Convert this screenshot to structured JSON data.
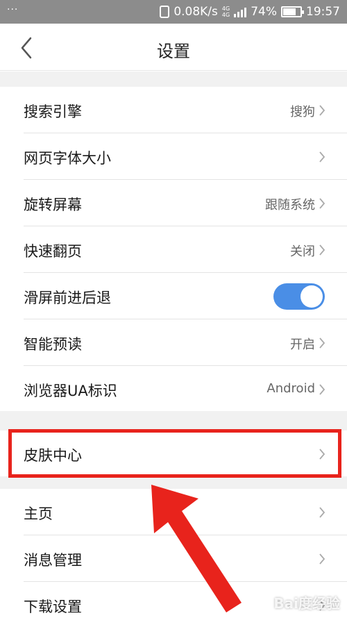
{
  "status_bar": {
    "left": "···",
    "speed": "0.08K/s",
    "network": [
      "4G",
      "4G"
    ],
    "battery_percent": 74,
    "battery_text": "74%",
    "time": "19:57"
  },
  "header": {
    "title": "设置",
    "back_icon": "chevron-left-icon"
  },
  "sections": [
    {
      "items": [
        {
          "label": "搜索引擎",
          "value": "搜狗",
          "chevron": true
        },
        {
          "label": "网页字体大小",
          "value": "",
          "chevron": true
        },
        {
          "label": "旋转屏幕",
          "value": "跟随系统",
          "chevron": true
        },
        {
          "label": "快速翻页",
          "value": "关闭",
          "chevron": true
        },
        {
          "label": "滑屏前进后退",
          "toggle": true,
          "toggle_on": true
        },
        {
          "label": "智能预读",
          "value": "开启",
          "chevron": true
        },
        {
          "label": "浏览器UA标识",
          "value": "Android",
          "chevron": true
        }
      ]
    },
    {
      "items": [
        {
          "label": "皮肤中心",
          "value": "",
          "chevron": true
        }
      ]
    },
    {
      "items": [
        {
          "label": "主页",
          "value": "",
          "chevron": true
        },
        {
          "label": "消息管理",
          "value": "",
          "chevron": true
        },
        {
          "label": "下载设置",
          "value": "",
          "chevron": true
        }
      ]
    }
  ],
  "annotation": {
    "highlight_color": "#e8231c",
    "toggle_color": "#4a8ee6"
  },
  "watermark": "Bai度经验"
}
